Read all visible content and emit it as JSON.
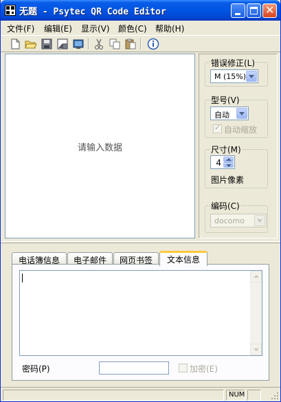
{
  "window": {
    "title": "无题 - Psytec QR Code Editor"
  },
  "menu": [
    "文件(F)",
    "编辑(E)",
    "显示(V)",
    "颜色(C)",
    "帮助(H)"
  ],
  "toolbar_icons": [
    "new-file-icon",
    "open-folder-icon",
    "save-icon",
    "save-as-image-icon",
    "display-icon",
    "cut-icon",
    "copy-icon",
    "paste-icon",
    "info-icon"
  ],
  "preview": {
    "placeholder": "请输入数据"
  },
  "settings": {
    "error_correction": {
      "label": "错误修正(L)",
      "value": "M (15%)"
    },
    "model": {
      "label": "型号(V)",
      "value": "自动",
      "auto_shrink_label": "自动缩放",
      "auto_shrink_checked": true
    },
    "size": {
      "label": "尺寸(M)",
      "value": "4",
      "unit": "图片像素"
    },
    "encoding": {
      "label": "编码(C)",
      "value": "docomo"
    }
  },
  "tabs": [
    "电话簿信息",
    "电子邮件",
    "网页书签",
    "文本信息"
  ],
  "active_tab": "文本信息",
  "text_panel": {
    "content": "",
    "password_label": "密码(P)",
    "password_value": "",
    "encrypt_label": "加密(E)",
    "encrypt_checked": false
  },
  "statusbar": {
    "main": "",
    "indicator": "NUM"
  },
  "colors": {
    "title_bar": "#0054e3",
    "window_bg": "#ece9d8",
    "active_tab_accent": "#ffc83c"
  }
}
